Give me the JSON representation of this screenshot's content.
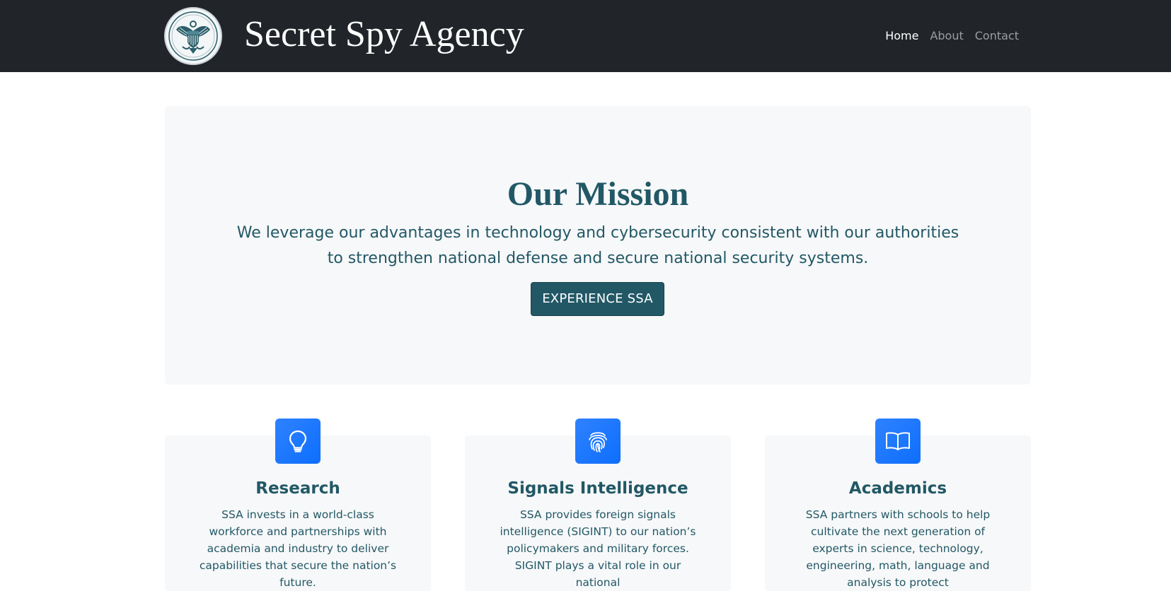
{
  "navbar": {
    "brand": "Secret Spy Agency",
    "logo_icon": "agency-seal-icon",
    "logo_text": "SSA",
    "links": [
      {
        "label": "Home",
        "active": true
      },
      {
        "label": "About",
        "active": false
      },
      {
        "label": "Contact",
        "active": false
      }
    ]
  },
  "hero": {
    "title": "Our Mission",
    "text": "We leverage our advantages in technology and cybersecurity consistent with our authorities to strengthen national defense and secure national security systems.",
    "button_label": "EXPERIENCE SSA"
  },
  "features": [
    {
      "icon": "lightbulb-icon",
      "title": "Research",
      "text": "SSA invests in a world-class workforce and partnerships with academia and industry to deliver capabilities that secure the nation’s future."
    },
    {
      "icon": "fingerprint-icon",
      "title": "Signals Intelligence",
      "text": "SSA provides foreign signals intelligence (SIGINT) to our nation’s policymakers and military forces. SIGINT plays a vital role in our national"
    },
    {
      "icon": "book-icon",
      "title": "Academics",
      "text": "SSA partners with schools to help cultivate the next generation of experts in science, technology, engineering, math, language and analysis to protect"
    }
  ],
  "colors": {
    "navbar_bg": "#212529",
    "primary_teal": "#225866",
    "icon_blue": "#0d6efd",
    "panel_bg": "#f7f8f9"
  }
}
